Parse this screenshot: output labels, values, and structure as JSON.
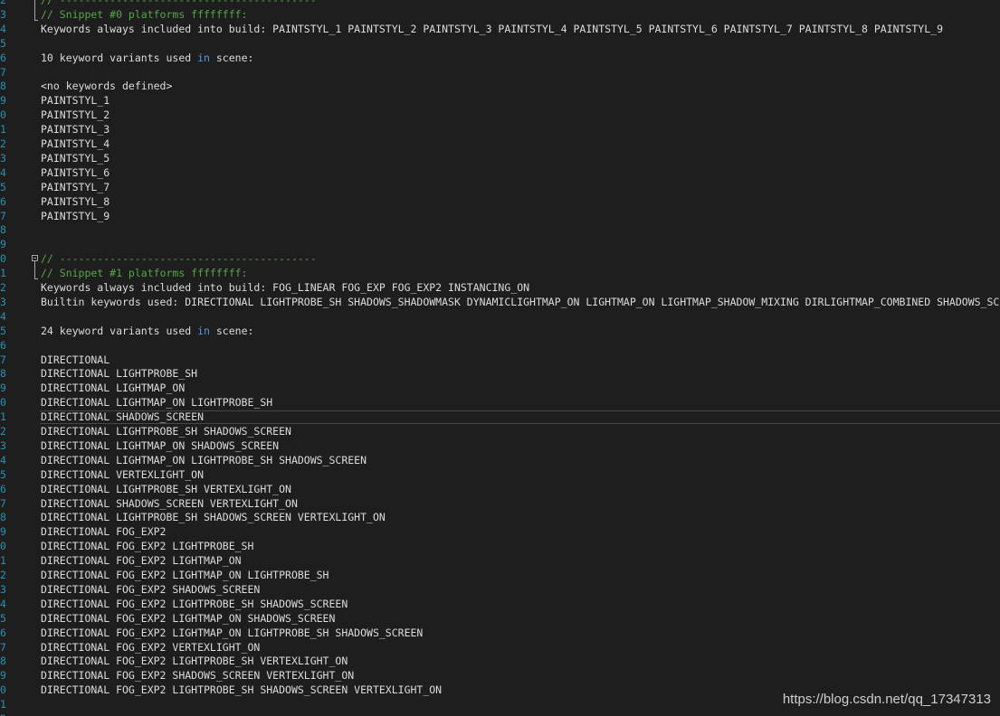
{
  "watermark": "https://blog.csdn.net/qq_17347313",
  "lines": [
    {
      "n": "2",
      "text": "// -----------------------------------------",
      "cls": "comment"
    },
    {
      "n": "3",
      "text": "// Snippet #0 platforms ffffffff:",
      "cls": "comment"
    },
    {
      "n": "4",
      "text": "Keywords always included into build: PAINTSTYL_1 PAINTSTYL_2 PAINTSTYL_3 PAINTSTYL_4 PAINTSTYL_5 PAINTSTYL_6 PAINTSTYL_7 PAINTSTYL_8 PAINTSTYL_9",
      "cls": ""
    },
    {
      "n": "5",
      "text": "",
      "cls": ""
    },
    {
      "n": "6",
      "pre": "10 keyword variants used ",
      "kw": "in",
      "post": " scene:",
      "cls": ""
    },
    {
      "n": "7",
      "text": "",
      "cls": ""
    },
    {
      "n": "8",
      "text": "<no keywords defined>",
      "cls": ""
    },
    {
      "n": "9",
      "text": "PAINTSTYL_1",
      "cls": ""
    },
    {
      "n": "0",
      "text": "PAINTSTYL_2",
      "cls": ""
    },
    {
      "n": "1",
      "text": "PAINTSTYL_3",
      "cls": ""
    },
    {
      "n": "2",
      "text": "PAINTSTYL_4",
      "cls": ""
    },
    {
      "n": "3",
      "text": "PAINTSTYL_5",
      "cls": ""
    },
    {
      "n": "4",
      "text": "PAINTSTYL_6",
      "cls": ""
    },
    {
      "n": "5",
      "text": "PAINTSTYL_7",
      "cls": ""
    },
    {
      "n": "6",
      "text": "PAINTSTYL_8",
      "cls": ""
    },
    {
      "n": "7",
      "text": "PAINTSTYL_9",
      "cls": ""
    },
    {
      "n": "8",
      "text": "",
      "cls": ""
    },
    {
      "n": "9",
      "text": "",
      "cls": ""
    },
    {
      "n": "0",
      "text": "// -----------------------------------------",
      "cls": "comment"
    },
    {
      "n": "1",
      "text": "// Snippet #1 platforms ffffffff:",
      "cls": "comment"
    },
    {
      "n": "2",
      "text": "Keywords always included into build: FOG_LINEAR FOG_EXP FOG_EXP2 INSTANCING_ON",
      "cls": ""
    },
    {
      "n": "3",
      "text": "Builtin keywords used: DIRECTIONAL LIGHTPROBE_SH SHADOWS_SHADOWMASK DYNAMICLIGHTMAP_ON LIGHTMAP_ON LIGHTMAP_SHADOW_MIXING DIRLIGHTMAP_COMBINED SHADOWS_SCREEN VERTEXLIGHT_ON",
      "cls": ""
    },
    {
      "n": "4",
      "text": "",
      "cls": ""
    },
    {
      "n": "5",
      "pre": "24 keyword variants used ",
      "kw": "in",
      "post": " scene:",
      "cls": ""
    },
    {
      "n": "6",
      "text": "",
      "cls": ""
    },
    {
      "n": "7",
      "text": "DIRECTIONAL",
      "cls": ""
    },
    {
      "n": "8",
      "text": "DIRECTIONAL LIGHTPROBE_SH",
      "cls": ""
    },
    {
      "n": "9",
      "text": "DIRECTIONAL LIGHTMAP_ON",
      "cls": ""
    },
    {
      "n": "0",
      "text": "DIRECTIONAL LIGHTMAP_ON LIGHTPROBE_SH",
      "cls": ""
    },
    {
      "n": "1",
      "text": "DIRECTIONAL SHADOWS_SCREEN",
      "cls": "",
      "current": true
    },
    {
      "n": "2",
      "text": "DIRECTIONAL LIGHTPROBE_SH SHADOWS_SCREEN",
      "cls": ""
    },
    {
      "n": "3",
      "text": "DIRECTIONAL LIGHTMAP_ON SHADOWS_SCREEN",
      "cls": ""
    },
    {
      "n": "4",
      "text": "DIRECTIONAL LIGHTMAP_ON LIGHTPROBE_SH SHADOWS_SCREEN",
      "cls": ""
    },
    {
      "n": "5",
      "text": "DIRECTIONAL VERTEXLIGHT_ON",
      "cls": ""
    },
    {
      "n": "6",
      "text": "DIRECTIONAL LIGHTPROBE_SH VERTEXLIGHT_ON",
      "cls": ""
    },
    {
      "n": "7",
      "text": "DIRECTIONAL SHADOWS_SCREEN VERTEXLIGHT_ON",
      "cls": ""
    },
    {
      "n": "8",
      "text": "DIRECTIONAL LIGHTPROBE_SH SHADOWS_SCREEN VERTEXLIGHT_ON",
      "cls": ""
    },
    {
      "n": "9",
      "text": "DIRECTIONAL FOG_EXP2",
      "cls": ""
    },
    {
      "n": "0",
      "text": "DIRECTIONAL FOG_EXP2 LIGHTPROBE_SH",
      "cls": ""
    },
    {
      "n": "1",
      "text": "DIRECTIONAL FOG_EXP2 LIGHTMAP_ON",
      "cls": ""
    },
    {
      "n": "2",
      "text": "DIRECTIONAL FOG_EXP2 LIGHTMAP_ON LIGHTPROBE_SH",
      "cls": ""
    },
    {
      "n": "3",
      "text": "DIRECTIONAL FOG_EXP2 SHADOWS_SCREEN",
      "cls": ""
    },
    {
      "n": "4",
      "text": "DIRECTIONAL FOG_EXP2 LIGHTPROBE_SH SHADOWS_SCREEN",
      "cls": ""
    },
    {
      "n": "5",
      "text": "DIRECTIONAL FOG_EXP2 LIGHTMAP_ON SHADOWS_SCREEN",
      "cls": ""
    },
    {
      "n": "6",
      "text": "DIRECTIONAL FOG_EXP2 LIGHTMAP_ON LIGHTPROBE_SH SHADOWS_SCREEN",
      "cls": ""
    },
    {
      "n": "7",
      "text": "DIRECTIONAL FOG_EXP2 VERTEXLIGHT_ON",
      "cls": ""
    },
    {
      "n": "8",
      "text": "DIRECTIONAL FOG_EXP2 LIGHTPROBE_SH VERTEXLIGHT_ON",
      "cls": ""
    },
    {
      "n": "9",
      "text": "DIRECTIONAL FOG_EXP2 SHADOWS_SCREEN VERTEXLIGHT_ON",
      "cls": ""
    },
    {
      "n": "0",
      "text": "DIRECTIONAL FOG_EXP2 LIGHTPROBE_SH SHADOWS_SCREEN VERTEXLIGHT_ON",
      "cls": ""
    },
    {
      "n": "1",
      "text": "",
      "cls": ""
    },
    {
      "n": "2",
      "text": "",
      "cls": ""
    }
  ]
}
